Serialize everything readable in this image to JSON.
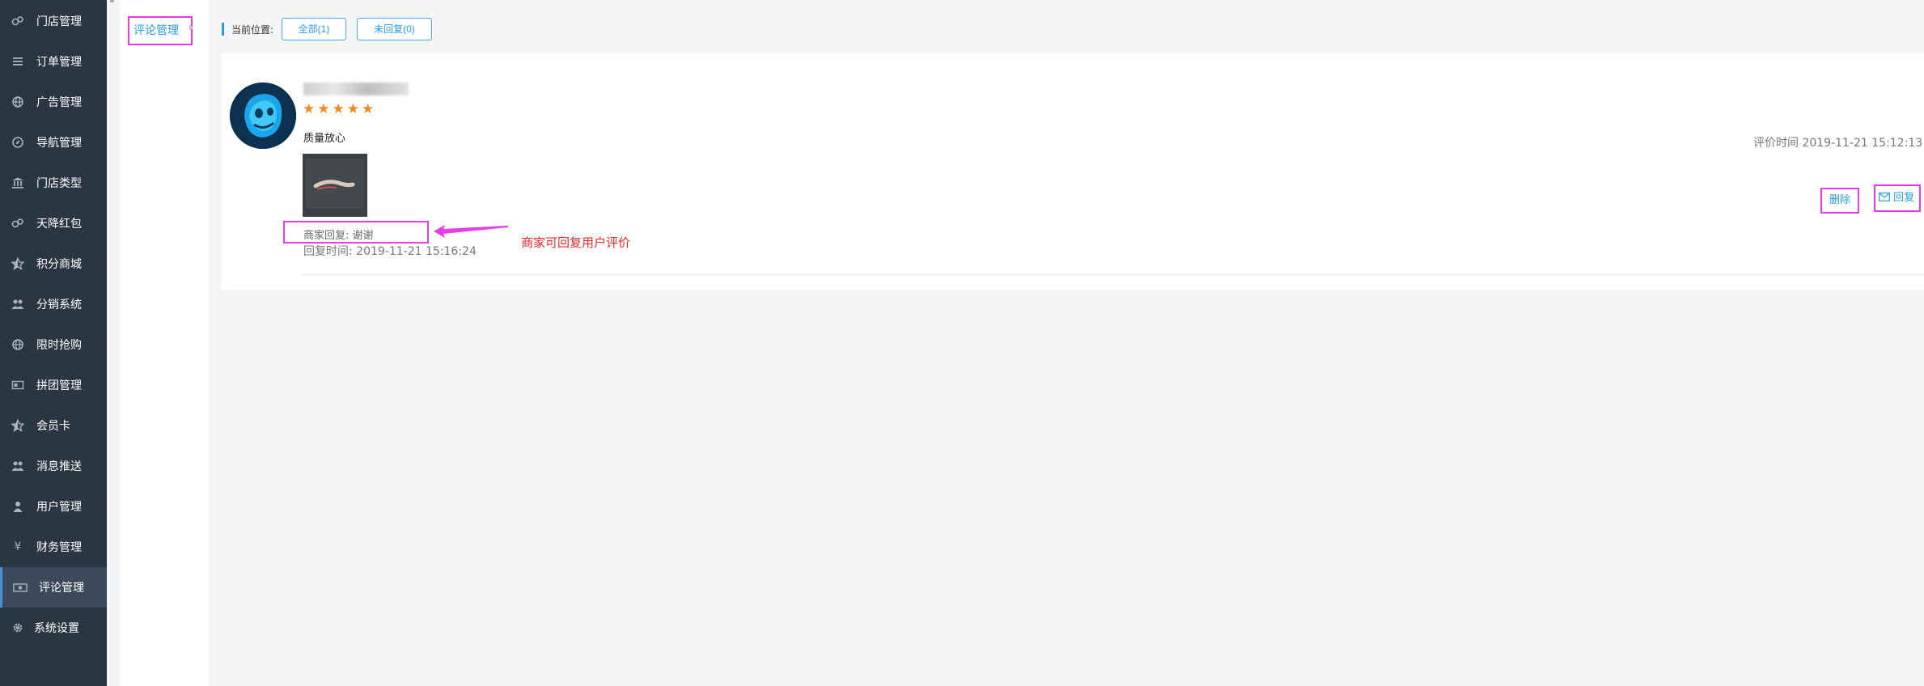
{
  "sidebar": {
    "items": [
      {
        "label": "门店管理",
        "icon": "cogs-icon"
      },
      {
        "label": "订单管理",
        "icon": "list-icon"
      },
      {
        "label": "广告管理",
        "icon": "globe-icon"
      },
      {
        "label": "导航管理",
        "icon": "compass-icon"
      },
      {
        "label": "门店类型",
        "icon": "bank-icon"
      },
      {
        "label": "天降红包",
        "icon": "cogs-icon"
      },
      {
        "label": "积分商城",
        "icon": "star-half-icon"
      },
      {
        "label": "分销系统",
        "icon": "users-icon"
      },
      {
        "label": "限时抢购",
        "icon": "globe-icon"
      },
      {
        "label": "拼团管理",
        "icon": "card-icon"
      },
      {
        "label": "会员卡",
        "icon": "star-half-icon"
      },
      {
        "label": "消息推送",
        "icon": "users-icon"
      },
      {
        "label": "用户管理",
        "icon": "user-icon"
      },
      {
        "label": "财务管理",
        "icon": "yen-icon"
      },
      {
        "label": "评论管理",
        "icon": "money-icon",
        "active": true
      },
      {
        "label": "系统设置",
        "icon": "gear-icon"
      }
    ]
  },
  "subnav": {
    "item_label": "评论管理"
  },
  "breadcrumb": {
    "label": "当前位置:",
    "filters": [
      {
        "label": "全部(1)"
      },
      {
        "label": "未回复(0)"
      }
    ]
  },
  "review": {
    "stars": 5,
    "comment": "质量放心",
    "review_time": "评价时间 2019-11-21 15:12:13",
    "delete_label": "删除",
    "reply_label": "回复",
    "merchant_reply": "商家回复: 谢谢",
    "reply_time": "回复时间: 2019-11-21 15:16:24"
  },
  "annotation": {
    "text": "商家可回复用户评价",
    "color": "#e8282a",
    "highlight_color": "#e53ce5"
  },
  "colors": {
    "sidebar_bg": "#2b3643",
    "accent": "#2a9be5",
    "star": "#f5891e"
  }
}
